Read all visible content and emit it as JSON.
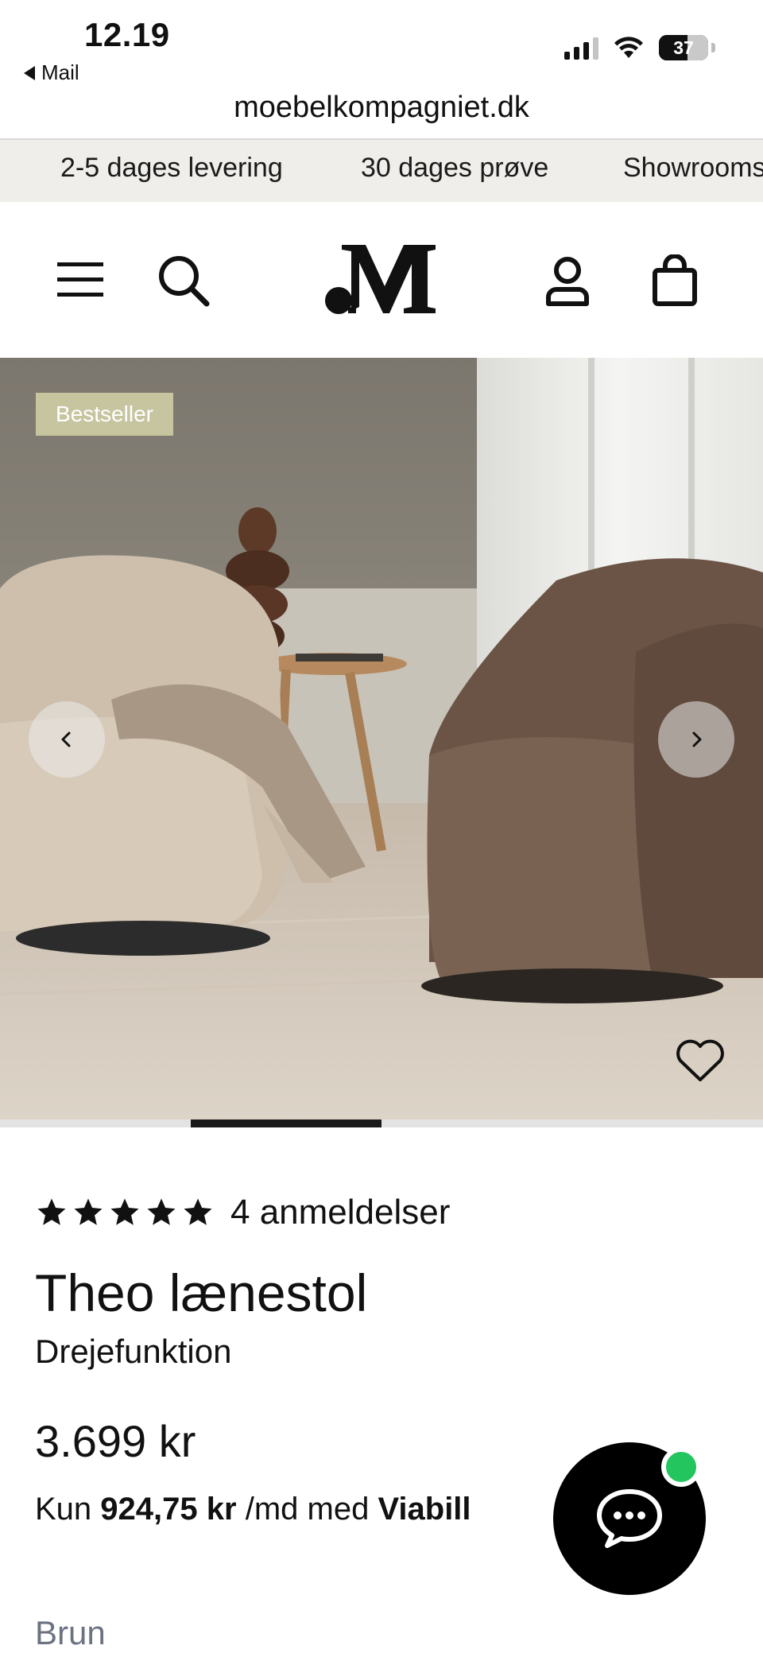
{
  "status_bar": {
    "time": "12.19",
    "back_label": "Mail",
    "battery": "37"
  },
  "browser": {
    "url": "moebelkompagniet.dk"
  },
  "usp_strip": {
    "items": [
      "2-5 dages levering",
      "30 dages prøve",
      "Showrooms"
    ]
  },
  "header": {
    "icons": [
      "menu-icon",
      "search-icon",
      "logo",
      "account-icon",
      "bag-icon"
    ]
  },
  "hero": {
    "badge": "Bestseller",
    "slide_progress": 0.25
  },
  "product": {
    "rating": 5,
    "reviews": "4 anmeldelser",
    "title": "Theo lænestol",
    "subtitle": "Drejefunktion",
    "price": "3.699 kr",
    "finance_prefix": "Kun",
    "finance_amount": "924,75 kr",
    "finance_mid": "/md med",
    "finance_provider": "Viabill",
    "color_label": "Brun"
  },
  "colors": {
    "strip_bg": "#efeeea",
    "badge_bg": "#c7c5a0",
    "chat_bg": "#000000",
    "online_dot": "#22c55e"
  }
}
